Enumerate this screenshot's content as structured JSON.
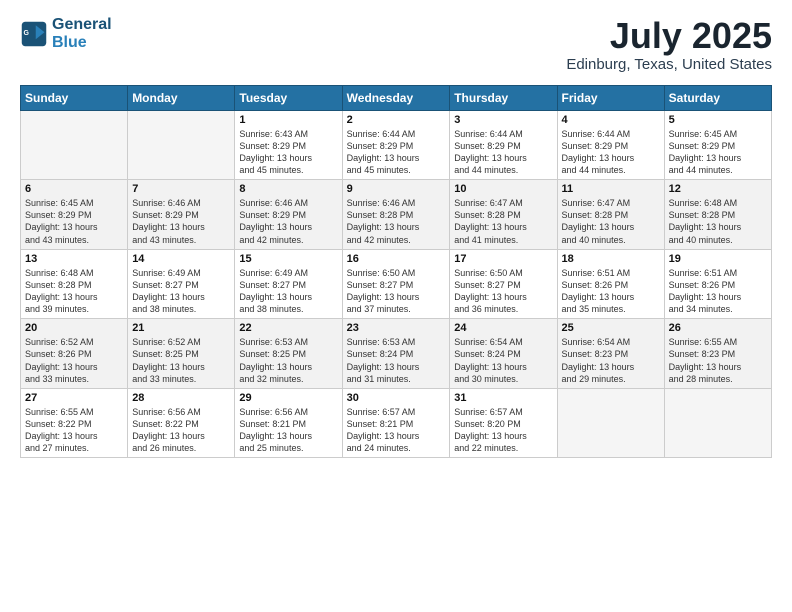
{
  "header": {
    "logo": {
      "line1": "General",
      "line2": "Blue"
    },
    "title": "July 2025",
    "location": "Edinburg, Texas, United States"
  },
  "weekdays": [
    "Sunday",
    "Monday",
    "Tuesday",
    "Wednesday",
    "Thursday",
    "Friday",
    "Saturday"
  ],
  "weeks": [
    [
      {
        "day": "",
        "empty": true
      },
      {
        "day": "",
        "empty": true
      },
      {
        "day": "1",
        "info": "Sunrise: 6:43 AM\nSunset: 8:29 PM\nDaylight: 13 hours\nand 45 minutes."
      },
      {
        "day": "2",
        "info": "Sunrise: 6:44 AM\nSunset: 8:29 PM\nDaylight: 13 hours\nand 45 minutes."
      },
      {
        "day": "3",
        "info": "Sunrise: 6:44 AM\nSunset: 8:29 PM\nDaylight: 13 hours\nand 44 minutes."
      },
      {
        "day": "4",
        "info": "Sunrise: 6:44 AM\nSunset: 8:29 PM\nDaylight: 13 hours\nand 44 minutes."
      },
      {
        "day": "5",
        "info": "Sunrise: 6:45 AM\nSunset: 8:29 PM\nDaylight: 13 hours\nand 44 minutes."
      }
    ],
    [
      {
        "day": "6",
        "info": "Sunrise: 6:45 AM\nSunset: 8:29 PM\nDaylight: 13 hours\nand 43 minutes."
      },
      {
        "day": "7",
        "info": "Sunrise: 6:46 AM\nSunset: 8:29 PM\nDaylight: 13 hours\nand 43 minutes."
      },
      {
        "day": "8",
        "info": "Sunrise: 6:46 AM\nSunset: 8:29 PM\nDaylight: 13 hours\nand 42 minutes."
      },
      {
        "day": "9",
        "info": "Sunrise: 6:46 AM\nSunset: 8:28 PM\nDaylight: 13 hours\nand 42 minutes."
      },
      {
        "day": "10",
        "info": "Sunrise: 6:47 AM\nSunset: 8:28 PM\nDaylight: 13 hours\nand 41 minutes."
      },
      {
        "day": "11",
        "info": "Sunrise: 6:47 AM\nSunset: 8:28 PM\nDaylight: 13 hours\nand 40 minutes."
      },
      {
        "day": "12",
        "info": "Sunrise: 6:48 AM\nSunset: 8:28 PM\nDaylight: 13 hours\nand 40 minutes."
      }
    ],
    [
      {
        "day": "13",
        "info": "Sunrise: 6:48 AM\nSunset: 8:28 PM\nDaylight: 13 hours\nand 39 minutes."
      },
      {
        "day": "14",
        "info": "Sunrise: 6:49 AM\nSunset: 8:27 PM\nDaylight: 13 hours\nand 38 minutes."
      },
      {
        "day": "15",
        "info": "Sunrise: 6:49 AM\nSunset: 8:27 PM\nDaylight: 13 hours\nand 38 minutes."
      },
      {
        "day": "16",
        "info": "Sunrise: 6:50 AM\nSunset: 8:27 PM\nDaylight: 13 hours\nand 37 minutes."
      },
      {
        "day": "17",
        "info": "Sunrise: 6:50 AM\nSunset: 8:27 PM\nDaylight: 13 hours\nand 36 minutes."
      },
      {
        "day": "18",
        "info": "Sunrise: 6:51 AM\nSunset: 8:26 PM\nDaylight: 13 hours\nand 35 minutes."
      },
      {
        "day": "19",
        "info": "Sunrise: 6:51 AM\nSunset: 8:26 PM\nDaylight: 13 hours\nand 34 minutes."
      }
    ],
    [
      {
        "day": "20",
        "info": "Sunrise: 6:52 AM\nSunset: 8:26 PM\nDaylight: 13 hours\nand 33 minutes."
      },
      {
        "day": "21",
        "info": "Sunrise: 6:52 AM\nSunset: 8:25 PM\nDaylight: 13 hours\nand 33 minutes."
      },
      {
        "day": "22",
        "info": "Sunrise: 6:53 AM\nSunset: 8:25 PM\nDaylight: 13 hours\nand 32 minutes."
      },
      {
        "day": "23",
        "info": "Sunrise: 6:53 AM\nSunset: 8:24 PM\nDaylight: 13 hours\nand 31 minutes."
      },
      {
        "day": "24",
        "info": "Sunrise: 6:54 AM\nSunset: 8:24 PM\nDaylight: 13 hours\nand 30 minutes."
      },
      {
        "day": "25",
        "info": "Sunrise: 6:54 AM\nSunset: 8:23 PM\nDaylight: 13 hours\nand 29 minutes."
      },
      {
        "day": "26",
        "info": "Sunrise: 6:55 AM\nSunset: 8:23 PM\nDaylight: 13 hours\nand 28 minutes."
      }
    ],
    [
      {
        "day": "27",
        "info": "Sunrise: 6:55 AM\nSunset: 8:22 PM\nDaylight: 13 hours\nand 27 minutes."
      },
      {
        "day": "28",
        "info": "Sunrise: 6:56 AM\nSunset: 8:22 PM\nDaylight: 13 hours\nand 26 minutes."
      },
      {
        "day": "29",
        "info": "Sunrise: 6:56 AM\nSunset: 8:21 PM\nDaylight: 13 hours\nand 25 minutes."
      },
      {
        "day": "30",
        "info": "Sunrise: 6:57 AM\nSunset: 8:21 PM\nDaylight: 13 hours\nand 24 minutes."
      },
      {
        "day": "31",
        "info": "Sunrise: 6:57 AM\nSunset: 8:20 PM\nDaylight: 13 hours\nand 22 minutes."
      },
      {
        "day": "",
        "empty": true
      },
      {
        "day": "",
        "empty": true
      }
    ]
  ]
}
